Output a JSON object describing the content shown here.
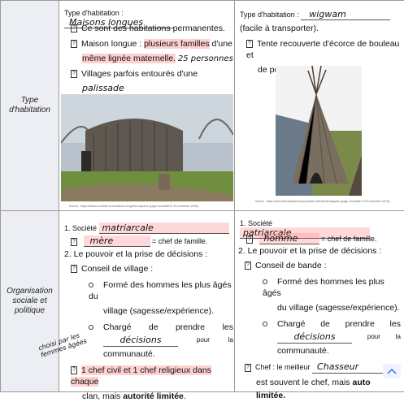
{
  "rows": [
    {
      "label": "Type d'habitation"
    },
    {
      "label": "Organisation sociale et politique"
    }
  ],
  "left_top": {
    "line1_prefix": "Type d'habitation :",
    "line1_hand": "Maisons longues",
    "b1": "Ce sont des habitations permanentes.",
    "b2_a": "Maison longue : ",
    "b2_hl1": "plusieurs familles",
    "b2_b": " d'une",
    "b2_hl2": "même lignée maternelle.",
    "b2_hand": "25 personnes",
    "b3": "Villages parfois entourés d'une",
    "b3_hand": "palissade",
    "src": "Source : https://maison-mobile.com/maisons-longues-iroquoise (page consultée le 29 novembre 2018)."
  },
  "right_top": {
    "line1_prefix": "Type d'habitation :",
    "line1_hand": "wigwam",
    "line2": "(facile à transporter).",
    "b1a": "Tente recouverte d'écorce de bouleau et",
    "b1b": "de peaux d'animaux.",
    "src": "Source : https://www.thecanadianencyclopedia.ca/fr/article/wigwam (page consultée le 29 novembre 2018)."
  },
  "left_bot": {
    "s1_prefix": "1. Société",
    "s1_hand": "matriarcale",
    "s1b_hand": "mère",
    "s1b_suffix": "= chef de famille.",
    "s2": "2. Le pouvoir et la prise de décisions :",
    "c1": "Conseil de village :",
    "o1a": "Formé des hommes les plus âgés du",
    "o1b": "village (sagesse/expérience).",
    "o2a": "Chargé",
    "o2b": "de",
    "o2c": "prendre",
    "o2d": "les",
    "o2_hand": "décisions",
    "o2e": "pour",
    "o2f": "la",
    "o2g": "communauté.",
    "margin_hand": "choisi par les femmes âgées",
    "c2a": "1 chef civil et 1 chef religieux dans chaque",
    "c2b_a": "clan, mais ",
    "c2b_bold": "autorité limitée",
    "c2b_c": "."
  },
  "right_bot": {
    "s1_prefix": "1. Société",
    "s1_hand": "patriarcale",
    "s1b_hand": "homme",
    "s1b_suffix": "= chef de famille.",
    "s2": "2. Le pouvoir et la prise de décisions :",
    "c1": "Conseil de bande :",
    "o1a": "Formé des hommes les plus âgés",
    "o1b": "du village (sagesse/expérience).",
    "o2a": "Chargé",
    "o2b": "de",
    "o2c": "prendre",
    "o2d": "les",
    "o2_hand": "décisions",
    "o2e": "pour",
    "o2f": "la",
    "o2g": "communauté.",
    "c2a": "Chef : le meilleur",
    "c2_hand": "Chasseur",
    "c2b": "est souvent le chef, mais ",
    "c2b_bold": "auto",
    "c2c": "limitée."
  }
}
